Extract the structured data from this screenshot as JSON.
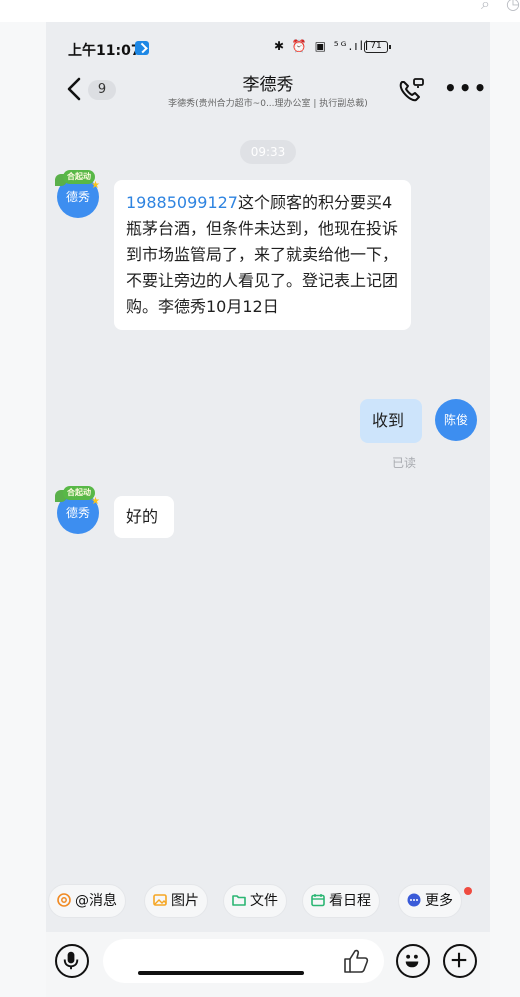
{
  "status_bar": {
    "time": "上午11:07",
    "icons": "✱ ⏰ ▣ ⁵ᴳ.ıll",
    "battery": "71"
  },
  "nav": {
    "unread_count": "9",
    "title": "李德秀",
    "subtitle": "李德秀(贵州合力超市~0...理办公室 | 执行副总裁)"
  },
  "chat": {
    "time_divider": "09:33",
    "messages": [
      {
        "sender_avatar_text": "德秀",
        "badge_text": "合起动",
        "phone": "19885099127",
        "text": "这个顾客的积分要买4瓶茅台酒，但条件未达到，他现在投诉到市场监管局了，来了就卖给他一下，不要让旁边的人看见了。登记表上记团购。李德秀10月12日"
      },
      {
        "sender_avatar_text": "陈俊",
        "text": "收到",
        "read_status": "已读"
      },
      {
        "sender_avatar_text": "德秀",
        "badge_text": "合起动",
        "text": "好的"
      }
    ]
  },
  "quick_actions": [
    {
      "label": "@消息",
      "icon": "at-icon",
      "color": "#f08a24"
    },
    {
      "label": "图片",
      "icon": "image-icon",
      "color": "#f5a623"
    },
    {
      "label": "文件",
      "icon": "folder-icon",
      "color": "#2bb673"
    },
    {
      "label": "看日程",
      "icon": "calendar-icon",
      "color": "#2bb673"
    },
    {
      "label": "更多",
      "icon": "more-circle-icon",
      "color": "#3a5bd8"
    }
  ],
  "input": {
    "placeholder": ""
  },
  "colors": {
    "accent_blue": "#3d8ef0",
    "link_blue": "#2f84e0",
    "my_bubble": "#cde4fb"
  }
}
